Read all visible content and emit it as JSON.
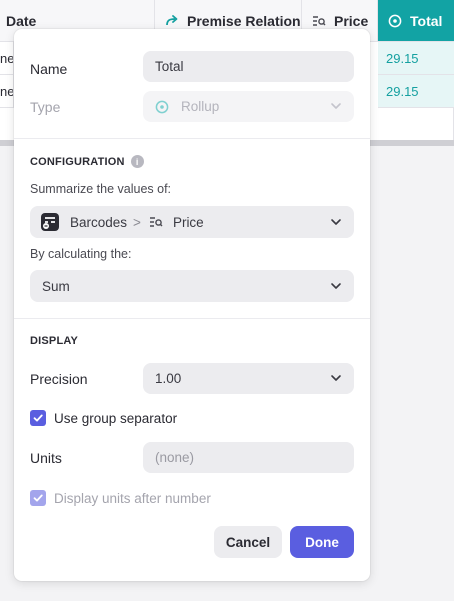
{
  "table": {
    "headers": {
      "date": "Date",
      "premise_relation": "Premise Relation",
      "price": "Price",
      "total": "Total"
    },
    "rows": [
      {
        "left_fragment": "ne",
        "total": "29.15"
      },
      {
        "left_fragment": "ne",
        "total": "29.15"
      }
    ]
  },
  "dialog": {
    "name_label": "Name",
    "name_value": "Total",
    "type_label": "Type",
    "type_value": "Rollup",
    "configuration_title": "CONFIGURATION",
    "info_glyph": "i",
    "summarize_label": "Summarize the values of:",
    "source_table": "Barcodes",
    "source_separator": ">",
    "source_field": "Price",
    "calculating_label": "By calculating the:",
    "calculation_value": "Sum",
    "display_title": "DISPLAY",
    "precision_label": "Precision",
    "precision_value": "1.00",
    "group_separator_label": "Use group separator",
    "group_separator_checked": true,
    "units_label": "Units",
    "units_placeholder": "(none)",
    "units_after_label": "Display units after number",
    "units_after_checked": true,
    "cancel_label": "Cancel",
    "done_label": "Done"
  },
  "colors": {
    "accent": "#5a5ee0",
    "teal": "#12a3a4",
    "teal_light": "#e6f6f6"
  },
  "icons": {
    "premise_relation": "arrow-relation-icon",
    "price": "lookup-field-icon",
    "total": "rollup-icon",
    "barcodes": "table-icon",
    "chevron": "chevron-down-icon",
    "check": "checkmark-icon"
  }
}
